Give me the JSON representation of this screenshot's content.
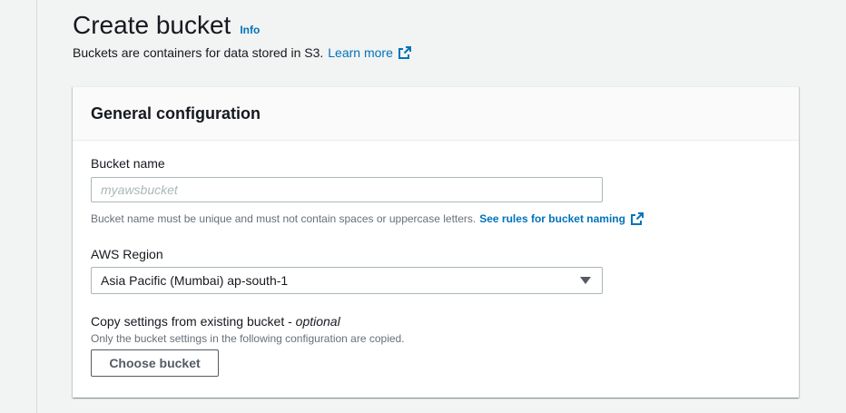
{
  "header": {
    "title": "Create bucket",
    "info_label": "Info",
    "description": "Buckets are containers for data stored in S3.",
    "learn_more_label": "Learn more"
  },
  "panel": {
    "title": "General configuration",
    "bucket_name": {
      "label": "Bucket name",
      "value": "",
      "placeholder": "myawsbucket",
      "hint": "Bucket name must be unique and must not contain spaces or uppercase letters.",
      "hint_link": "See rules for bucket naming"
    },
    "region": {
      "label": "AWS Region",
      "selected": "Asia Pacific (Mumbai) ap-south-1"
    },
    "copy_settings": {
      "label": "Copy settings from existing bucket - ",
      "optional": "optional",
      "hint": "Only the bucket settings in the following configuration are copied.",
      "button_label": "Choose bucket"
    }
  },
  "colors": {
    "link": "#0073bb",
    "page_background": "#f2f3f3",
    "panel_header_background": "#fafafa",
    "border": "#aab7b8"
  },
  "icons": {
    "external_link": "external-link-icon",
    "select_caret": "caret-down-icon"
  }
}
